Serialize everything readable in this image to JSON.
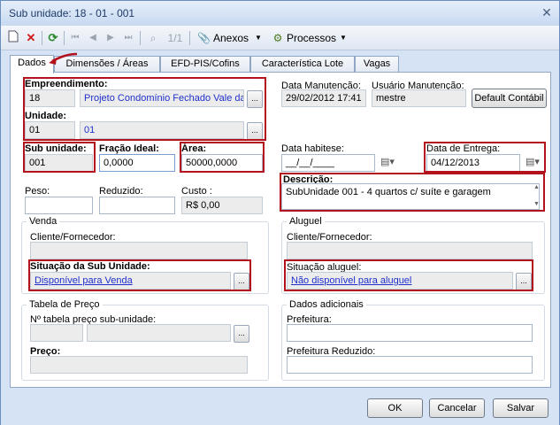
{
  "window": {
    "title": "Sub unidade: 18 - 01 - 001",
    "close_glyph": "✕"
  },
  "toolbar": {
    "page_indicator": "1/1",
    "anexos_label": "Anexos",
    "processos_label": "Processos"
  },
  "tabs": [
    {
      "label": "Dados",
      "active": true
    },
    {
      "label": "Dimensões / Áreas"
    },
    {
      "label": "EFD-PIS/Cofins"
    },
    {
      "label": "Característica Lote"
    },
    {
      "label": "Vagas"
    }
  ],
  "form": {
    "empreendimento": {
      "label": "Empreendimento:",
      "code": "18",
      "name": "Projeto Condomínio Fechado Vale das A"
    },
    "unidade": {
      "label": "Unidade:",
      "code": "01",
      "name": "01"
    },
    "data_manutencao": {
      "label": "Data Manutenção:",
      "value": "29/02/2012 17:41"
    },
    "usuario_manutencao": {
      "label": "Usuário Manutenção:",
      "value": "mestre"
    },
    "default_contabil_label": "Default Contábil",
    "sub_unidade": {
      "label": "Sub unidade:",
      "value": "001"
    },
    "fracao_ideal": {
      "label": "Fração Ideal:",
      "value": "0,0000"
    },
    "area": {
      "label": "Área:",
      "value": "50000,0000"
    },
    "data_habitese": {
      "label": "Data habitese:",
      "value": "__/__/____"
    },
    "data_entrega": {
      "label": "Data de Entrega:",
      "value": "04/12/2013"
    },
    "peso": {
      "label": "Peso:",
      "value": ""
    },
    "reduzido": {
      "label": "Reduzido:",
      "value": ""
    },
    "custo": {
      "label": "Custo :",
      "value": "R$ 0,00"
    },
    "descricao": {
      "label": "Descrição:",
      "value": "SubUnidade 001 - 4 quartos c/ suíte e garagem"
    }
  },
  "venda": {
    "title": "Venda",
    "cliente_label": "Cliente/Fornecedor:",
    "cliente_value": "",
    "situacao_label": "Situação da Sub Unidade:",
    "situacao_value": "Disponível para Venda"
  },
  "aluguel": {
    "title": "Aluguel",
    "cliente_label": "Cliente/Fornecedor:",
    "cliente_value": "",
    "situacao_label": "Situação aluguel:",
    "situacao_value": "Não disponível para aluguel"
  },
  "tabela_preco": {
    "title": "Tabela de Preço",
    "numero_label": "Nº tabela preço sub-unidade:",
    "preco_label": "Preço:"
  },
  "dados_adicionais": {
    "title": "Dados adicionais",
    "prefeitura_label": "Prefeitura:",
    "prefeitura_reduzido_label": "Prefeitura Reduzido:"
  },
  "footer": {
    "ok_label": "OK",
    "cancelar_label": "Cancelar",
    "salvar_label": "Salvar"
  },
  "ellipsis": "...",
  "colors": {
    "highlight_red": "#b3121c",
    "link_blue": "#1f2fcc"
  }
}
